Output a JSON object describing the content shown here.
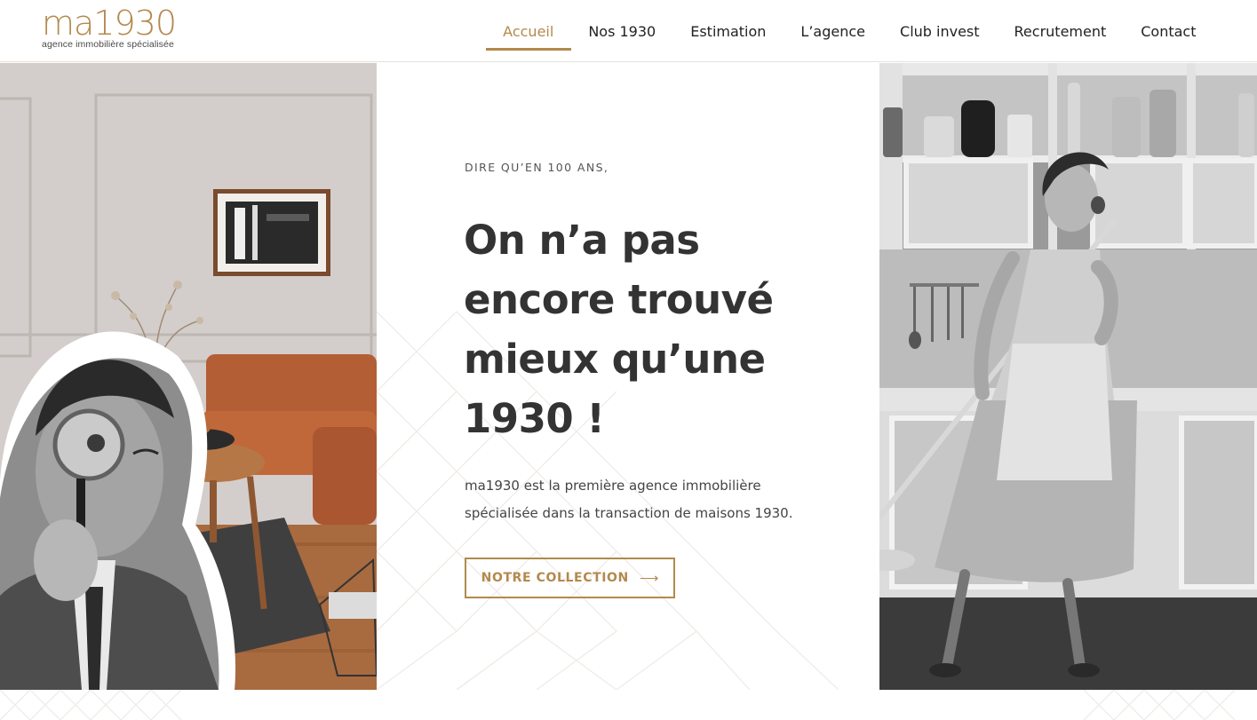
{
  "header": {
    "logo_mark": "ma1930",
    "logo_tagline": "agence immobilière spécialisée"
  },
  "nav": {
    "items": [
      {
        "label": "Accueil",
        "active": true
      },
      {
        "label": "Nos 1930"
      },
      {
        "label": "Estimation"
      },
      {
        "label": "L’agence"
      },
      {
        "label": "Club invest"
      },
      {
        "label": "Recrutement"
      },
      {
        "label": "Contact"
      }
    ]
  },
  "hero": {
    "eyebrow": "DIRE QU’EN 100 ANS,",
    "title_lines": [
      "On n’a pas",
      "encore trouvé",
      "mieux qu’une",
      "1930 !"
    ],
    "text_lines": [
      "ma1930 est la première agence immobilière",
      "spécialisée dans la transaction de maisons 1930."
    ],
    "cta_label": "NOTRE COLLECTION",
    "cta_arrow": "⟶"
  },
  "colors": {
    "accent": "#b3894d",
    "text_dark": "#333333"
  }
}
